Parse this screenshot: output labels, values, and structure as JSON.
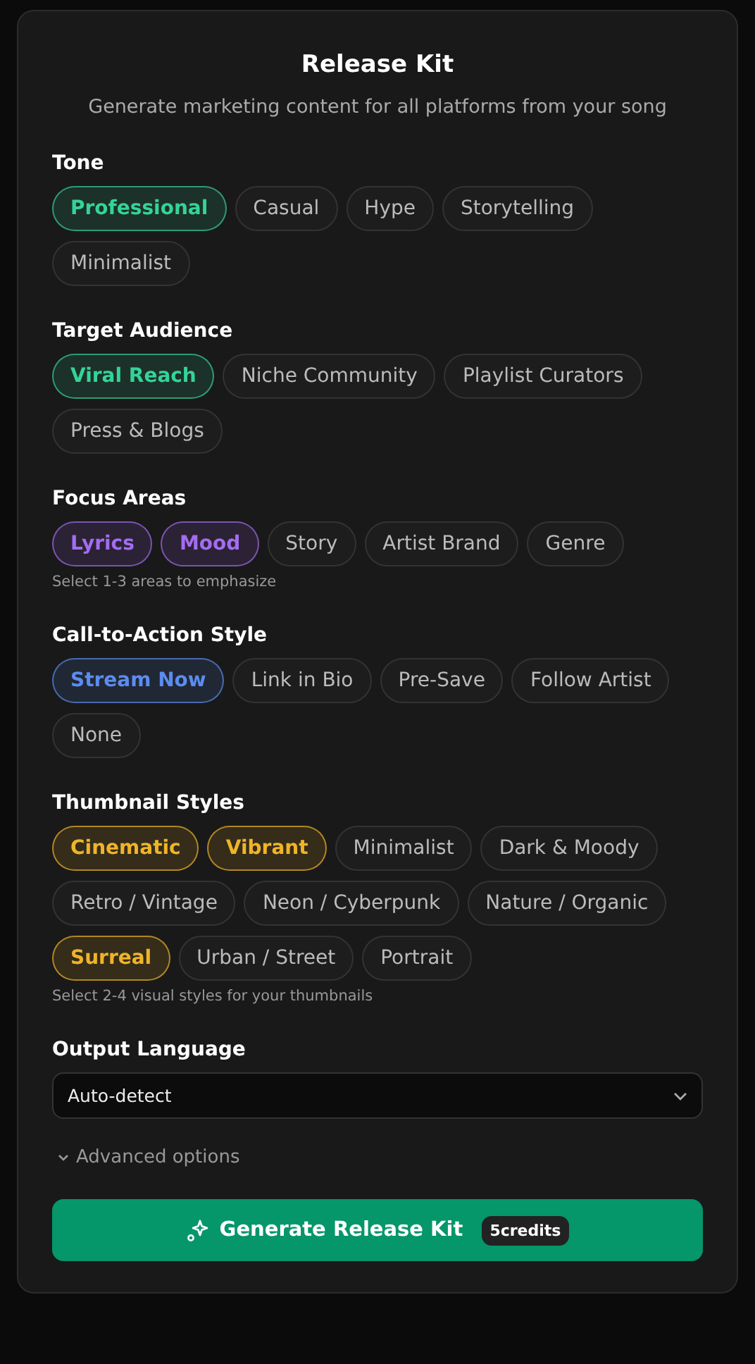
{
  "title": "Release Kit",
  "subtitle": "Generate marketing content for all platforms from your song",
  "sections": [
    {
      "label": "Tone",
      "color": "#34d399",
      "chips": [
        {
          "label": "Professional",
          "selected": true
        },
        {
          "label": "Casual",
          "selected": false
        },
        {
          "label": "Hype",
          "selected": false
        },
        {
          "label": "Storytelling",
          "selected": false
        },
        {
          "label": "Minimalist",
          "selected": false
        }
      ]
    },
    {
      "label": "Target Audience",
      "color": "#34d399",
      "chips": [
        {
          "label": "Viral Reach",
          "selected": true
        },
        {
          "label": "Niche Community",
          "selected": false
        },
        {
          "label": "Playlist Curators",
          "selected": false
        },
        {
          "label": "Press & Blogs",
          "selected": false
        }
      ]
    },
    {
      "label": "Focus Areas",
      "color": "#a46cf0",
      "hint": "Select 1-3 areas to emphasize",
      "chips": [
        {
          "label": "Lyrics",
          "selected": true
        },
        {
          "label": "Mood",
          "selected": true
        },
        {
          "label": "Story",
          "selected": false
        },
        {
          "label": "Artist Brand",
          "selected": false
        },
        {
          "label": "Genre",
          "selected": false
        }
      ]
    },
    {
      "label": "Call-to-Action Style",
      "color": "#5b8cf0",
      "chips": [
        {
          "label": "Stream Now",
          "selected": true
        },
        {
          "label": "Link in Bio",
          "selected": false
        },
        {
          "label": "Pre-Save",
          "selected": false
        },
        {
          "label": "Follow Artist",
          "selected": false
        },
        {
          "label": "None",
          "selected": false
        }
      ]
    },
    {
      "label": "Thumbnail Styles",
      "color": "#f0b429",
      "hint": "Select 2-4 visual styles for your thumbnails",
      "chips": [
        {
          "label": "Cinematic",
          "selected": true
        },
        {
          "label": "Vibrant",
          "selected": true
        },
        {
          "label": "Minimalist",
          "selected": false
        },
        {
          "label": "Dark & Moody",
          "selected": false
        },
        {
          "label": "Retro / Vintage",
          "selected": false
        },
        {
          "label": "Neon / Cyberpunk",
          "selected": false
        },
        {
          "label": "Nature / Organic",
          "selected": false
        },
        {
          "label": "Surreal",
          "selected": true
        },
        {
          "label": "Urban / Street",
          "selected": false
        },
        {
          "label": "Portrait",
          "selected": false
        }
      ]
    }
  ],
  "language": {
    "label": "Output Language",
    "value": "Auto-detect"
  },
  "advanced": {
    "label": "Advanced options",
    "expanded": false
  },
  "generate": {
    "label": "Generate Release Kit",
    "badge": "5credits"
  }
}
